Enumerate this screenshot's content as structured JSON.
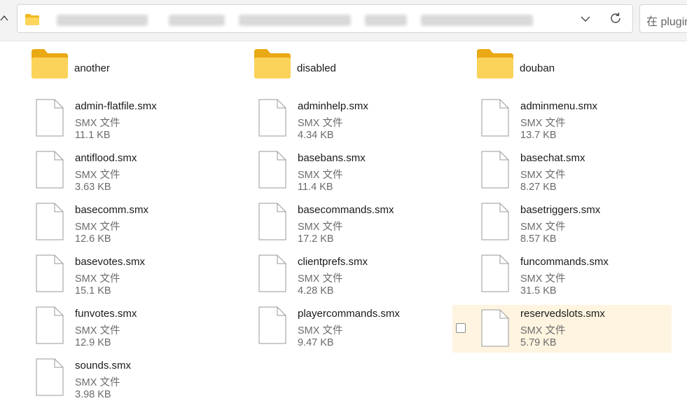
{
  "search": {
    "placeholder": "在 plugins"
  },
  "folders": [
    {
      "name": "another"
    },
    {
      "name": "disabled"
    },
    {
      "name": "douban"
    }
  ],
  "files": [
    {
      "name": "admin-flatfile.smx",
      "type": "SMX 文件",
      "size": "11.1 KB"
    },
    {
      "name": "adminhelp.smx",
      "type": "SMX 文件",
      "size": "4.34 KB"
    },
    {
      "name": "adminmenu.smx",
      "type": "SMX 文件",
      "size": "13.7 KB"
    },
    {
      "name": "antiflood.smx",
      "type": "SMX 文件",
      "size": "3.63 KB"
    },
    {
      "name": "basebans.smx",
      "type": "SMX 文件",
      "size": "11.4 KB"
    },
    {
      "name": "basechat.smx",
      "type": "SMX 文件",
      "size": "8.27 KB"
    },
    {
      "name": "basecomm.smx",
      "type": "SMX 文件",
      "size": "12.6 KB"
    },
    {
      "name": "basecommands.smx",
      "type": "SMX 文件",
      "size": "17.2 KB"
    },
    {
      "name": "basetriggers.smx",
      "type": "SMX 文件",
      "size": "8.57 KB"
    },
    {
      "name": "basevotes.smx",
      "type": "SMX 文件",
      "size": "15.1 KB"
    },
    {
      "name": "clientprefs.smx",
      "type": "SMX 文件",
      "size": "4.28 KB"
    },
    {
      "name": "funcommands.smx",
      "type": "SMX 文件",
      "size": "31.5 KB"
    },
    {
      "name": "funvotes.smx",
      "type": "SMX 文件",
      "size": "12.9 KB"
    },
    {
      "name": "playercommands.smx",
      "type": "SMX 文件",
      "size": "9.47 KB"
    },
    {
      "name": "reservedslots.smx",
      "type": "SMX 文件",
      "size": "5.79 KB",
      "hovered": true
    },
    {
      "name": "sounds.smx",
      "type": "SMX 文件",
      "size": "3.98 KB"
    }
  ],
  "colors": {
    "folder": "#f7c948",
    "hover_background": "#fff4e0"
  }
}
